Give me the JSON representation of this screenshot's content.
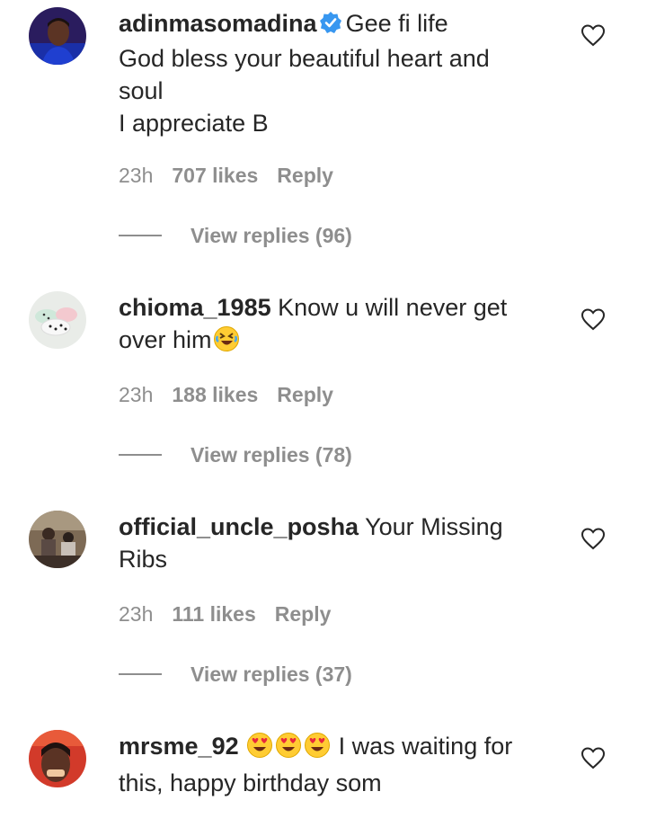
{
  "comments": [
    {
      "username": "adinmasomadina",
      "text_lines": [
        "Gee fi life",
        "God bless your beautiful heart and",
        "soul",
        "I appreciate B"
      ],
      "time": "23h",
      "likes": "707 likes",
      "reply": "Reply",
      "view_replies": "View replies (96)"
    },
    {
      "username": "chioma_1985",
      "text_lines": [
        "Know u will never get",
        "over him"
      ],
      "time": "23h",
      "likes": "188 likes",
      "reply": "Reply",
      "view_replies": "View replies (78)"
    },
    {
      "username": "official_uncle_posha",
      "text_lines": [
        "Your Missing",
        "Ribs"
      ],
      "time": "23h",
      "likes": "111 likes",
      "reply": "Reply",
      "view_replies": "View replies (37)"
    },
    {
      "username": "mrsme_92",
      "text_lines": [
        "I was waiting for",
        "this, happy birthday som"
      ]
    }
  ],
  "colors": {
    "text": "#262626",
    "muted": "#8e8e8e",
    "verified": "#3897f0"
  },
  "icons": [
    "verified-badge-icon",
    "heart-icon",
    "rolling-laughing-emoji-icon",
    "heart-eyes-emoji-icon"
  ]
}
